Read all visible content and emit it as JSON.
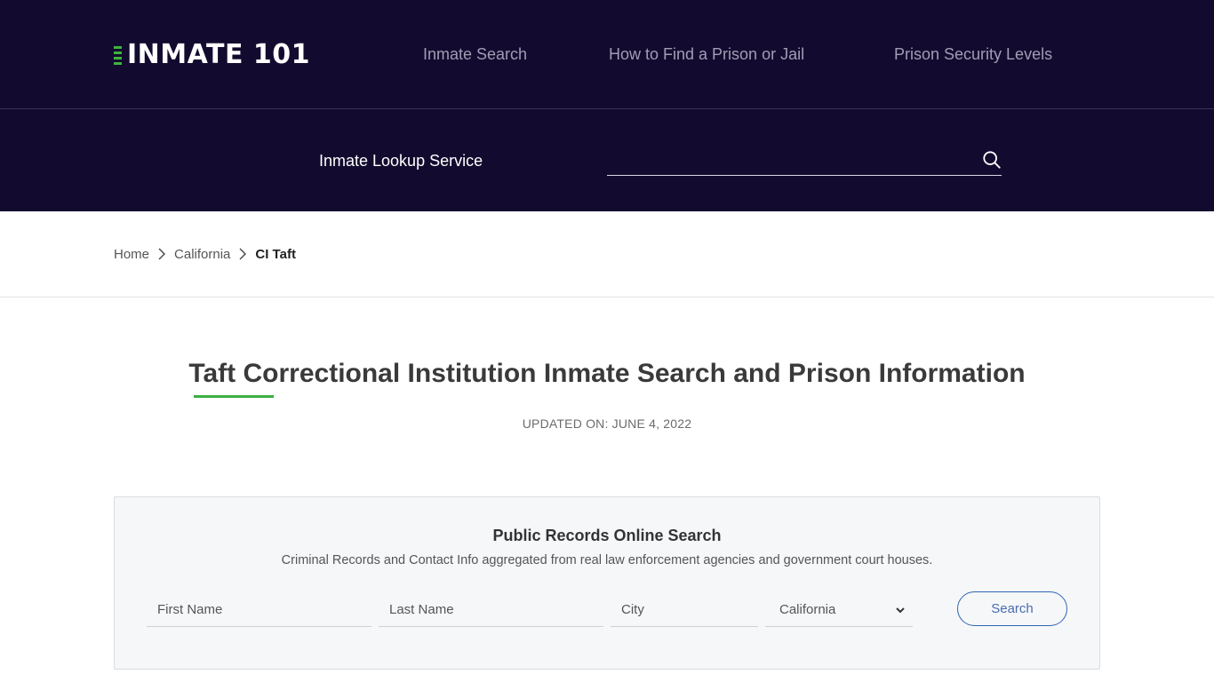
{
  "header": {
    "logo_text": "INMATE 101",
    "nav": [
      {
        "label": "Inmate Search"
      },
      {
        "label": "How to Find a Prison or Jail"
      },
      {
        "label": "Prison Security Levels"
      }
    ]
  },
  "lookup": {
    "label": "Inmate Lookup Service",
    "input_value": "",
    "input_placeholder": "",
    "icon": "search-icon"
  },
  "breadcrumb": {
    "items": [
      {
        "label": "Home"
      },
      {
        "label": "California"
      }
    ],
    "current": "CI Taft"
  },
  "main": {
    "title": "Taft Correctional Institution Inmate Search and Prison Information",
    "updated": "UPDATED ON: JUNE 4, 2022"
  },
  "records_search": {
    "title": "Public Records Online Search",
    "subtitle": "Criminal Records and Contact Info aggregated from real law enforcement agencies and government court houses.",
    "first_name_placeholder": "First Name",
    "last_name_placeholder": "Last Name",
    "city_placeholder": "City",
    "state_selected": "California",
    "button_label": "Search"
  },
  "colors": {
    "header_bg": "#130b2f",
    "accent_green": "#3cb043",
    "button_blue": "#2f66b3",
    "panel_bg": "#f6f7f9"
  }
}
